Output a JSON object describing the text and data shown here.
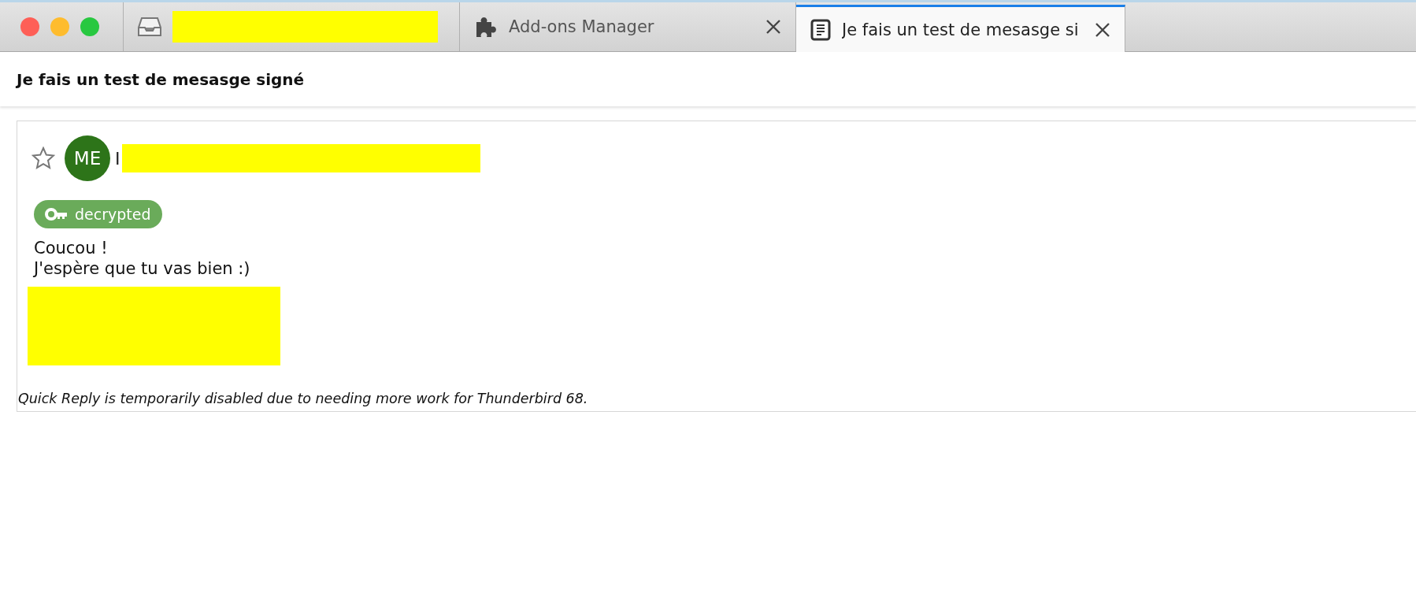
{
  "tabs": [
    {
      "kind": "inbox",
      "label_redacted": true,
      "closable": false,
      "selected": false
    },
    {
      "kind": "addons",
      "label": "Add-ons Manager",
      "closable": true,
      "selected": false
    },
    {
      "kind": "message",
      "label": "Je fais un test de mesasge si",
      "closable": true,
      "selected": true
    }
  ],
  "subject": "Je fais un test de mesasge signé",
  "message": {
    "starred": false,
    "avatar": {
      "initials": "ME",
      "color": "#2d7419"
    },
    "sender": {
      "name": "I",
      "redacted": true
    },
    "badge": {
      "label": "decrypted"
    },
    "body": [
      "Coucou !",
      "J'espère que tu vas bien :)"
    ],
    "signature_redacted": true,
    "notice": "Quick Reply is temporarily disabled due to needing more work for Thunderbird 68."
  }
}
